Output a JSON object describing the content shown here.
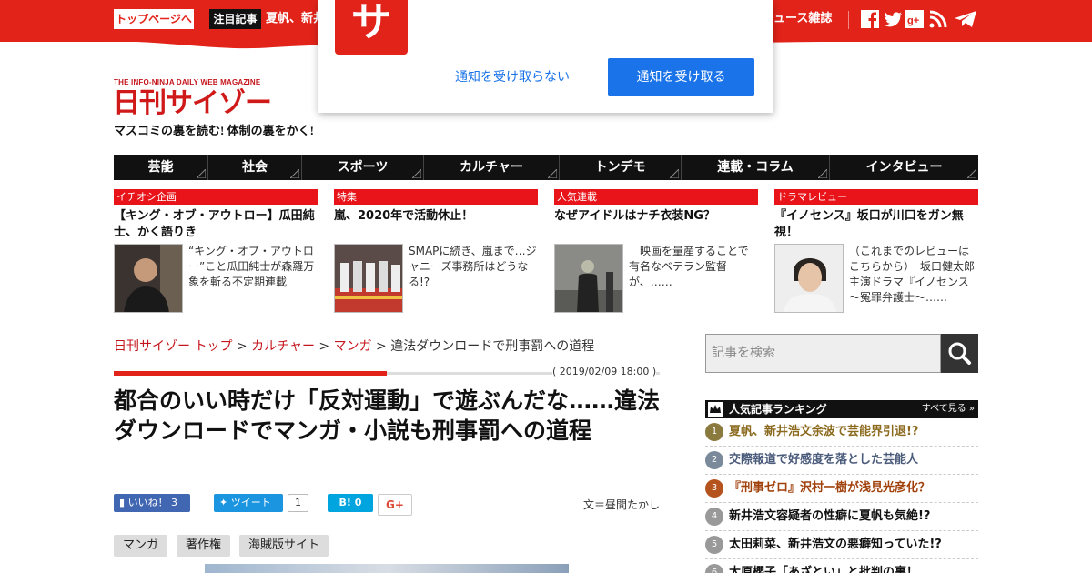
{
  "topbar": {
    "home_button": "トップページへ",
    "featured_badge": "注目記事",
    "featured_text": "夏帆、新井",
    "news_magazine": "ュース雑誌",
    "social_icons": [
      "facebook-icon",
      "twitter-icon",
      "google-plus-icon",
      "rss-icon",
      "telegram-icon"
    ]
  },
  "notification": {
    "logo_glyph": "サ",
    "cancel_label": "通知を受け取らない",
    "accept_label": "通知を受け取る"
  },
  "logo": {
    "subtitle": "THE INFO-NINJA DAILY WEB MAGAZINE",
    "title": "日刊サイゾー",
    "tagline": "マスコミの裏を読む! 体制の裏をかく!"
  },
  "nav": {
    "items": [
      "芸能",
      "社会",
      "スポーツ",
      "カルチャー",
      "トンデモ",
      "連載・コラム",
      "インタビュー"
    ]
  },
  "cards": [
    {
      "category": "イチオシ企画",
      "title": "【キング・オブ・アウトロー】瓜田純士、かく語りき",
      "desc": "“キング・オブ・アウトロー”こと瓜田純士が森羅万象を斬る不定期連載"
    },
    {
      "category": "特集",
      "title": "嵐、2020年で活動休止！",
      "desc": "SMAPに続き、嵐まで…ジャニーズ事務所はどうなる!?"
    },
    {
      "category": "人気連載",
      "title": "なぜアイドルはナチ衣装NG？",
      "desc": "　映画を量産することで有名なベテラン監督が、……"
    },
    {
      "category": "ドラマレビュー",
      "title": "『イノセンス』坂口が川口をガン無視！",
      "desc": "（これまでのレビューはこちらから）　坂口健太郎主演ドラマ『イノセンス～冤罪弁護士～……"
    }
  ],
  "breadcrumb": {
    "home": "日刊サイゾー トップ",
    "sep": " > ",
    "culture": "カルチャー",
    "manga": "マンガ",
    "current": "違法ダウンロードで刑事罰への道程"
  },
  "article": {
    "date": "( 2019/02/09 18:00 )",
    "headline": "都合のいい時だけ「反対運動」で遊ぶんだな……違法ダウンロードでマンガ・小説も刑事罰への道程",
    "author": "文＝昼間たかし",
    "tags": [
      "マンガ",
      "著作権",
      "海賊版サイト"
    ]
  },
  "share": {
    "fb_label": "いいね！ 3",
    "tw_label": "ツイート",
    "tw_count": "1",
    "hb_label": "B! 0",
    "gp_label": "G+"
  },
  "sidebar": {
    "search_placeholder": "記事を検索",
    "ranking_title": "人気記事ランキング",
    "ranking_all": "すべて見る »",
    "ranking": [
      {
        "num": "1",
        "text": "夏帆、新井浩文余波で芸能界引退!?",
        "color": "#8b7a3e",
        "text_color": "#8b6a1e"
      },
      {
        "num": "2",
        "text": "交際報道で好感度を落とした芸能人",
        "color": "#7a8a9a",
        "text_color": "#4a5a7a"
      },
      {
        "num": "3",
        "text": "『刑事ゼロ』沢村一樹が浅見光彦化？",
        "color": "#b5531e",
        "text_color": "#a0400a"
      },
      {
        "num": "4",
        "text": "新井浩文容疑者の性癖に夏帆も気絶!?",
        "color": "#999999",
        "text_color": "#111111"
      },
      {
        "num": "5",
        "text": "太田莉菜、新井浩文の悪癖知っていた!?",
        "color": "#999999",
        "text_color": "#111111"
      },
      {
        "num": "6",
        "text": "大原櫻子「あざとい」と批判の裏！",
        "color": "#999999",
        "text_color": "#111111"
      }
    ]
  },
  "colors": {
    "brand_red": "#e2231a",
    "accent_blue": "#1a73e8"
  }
}
